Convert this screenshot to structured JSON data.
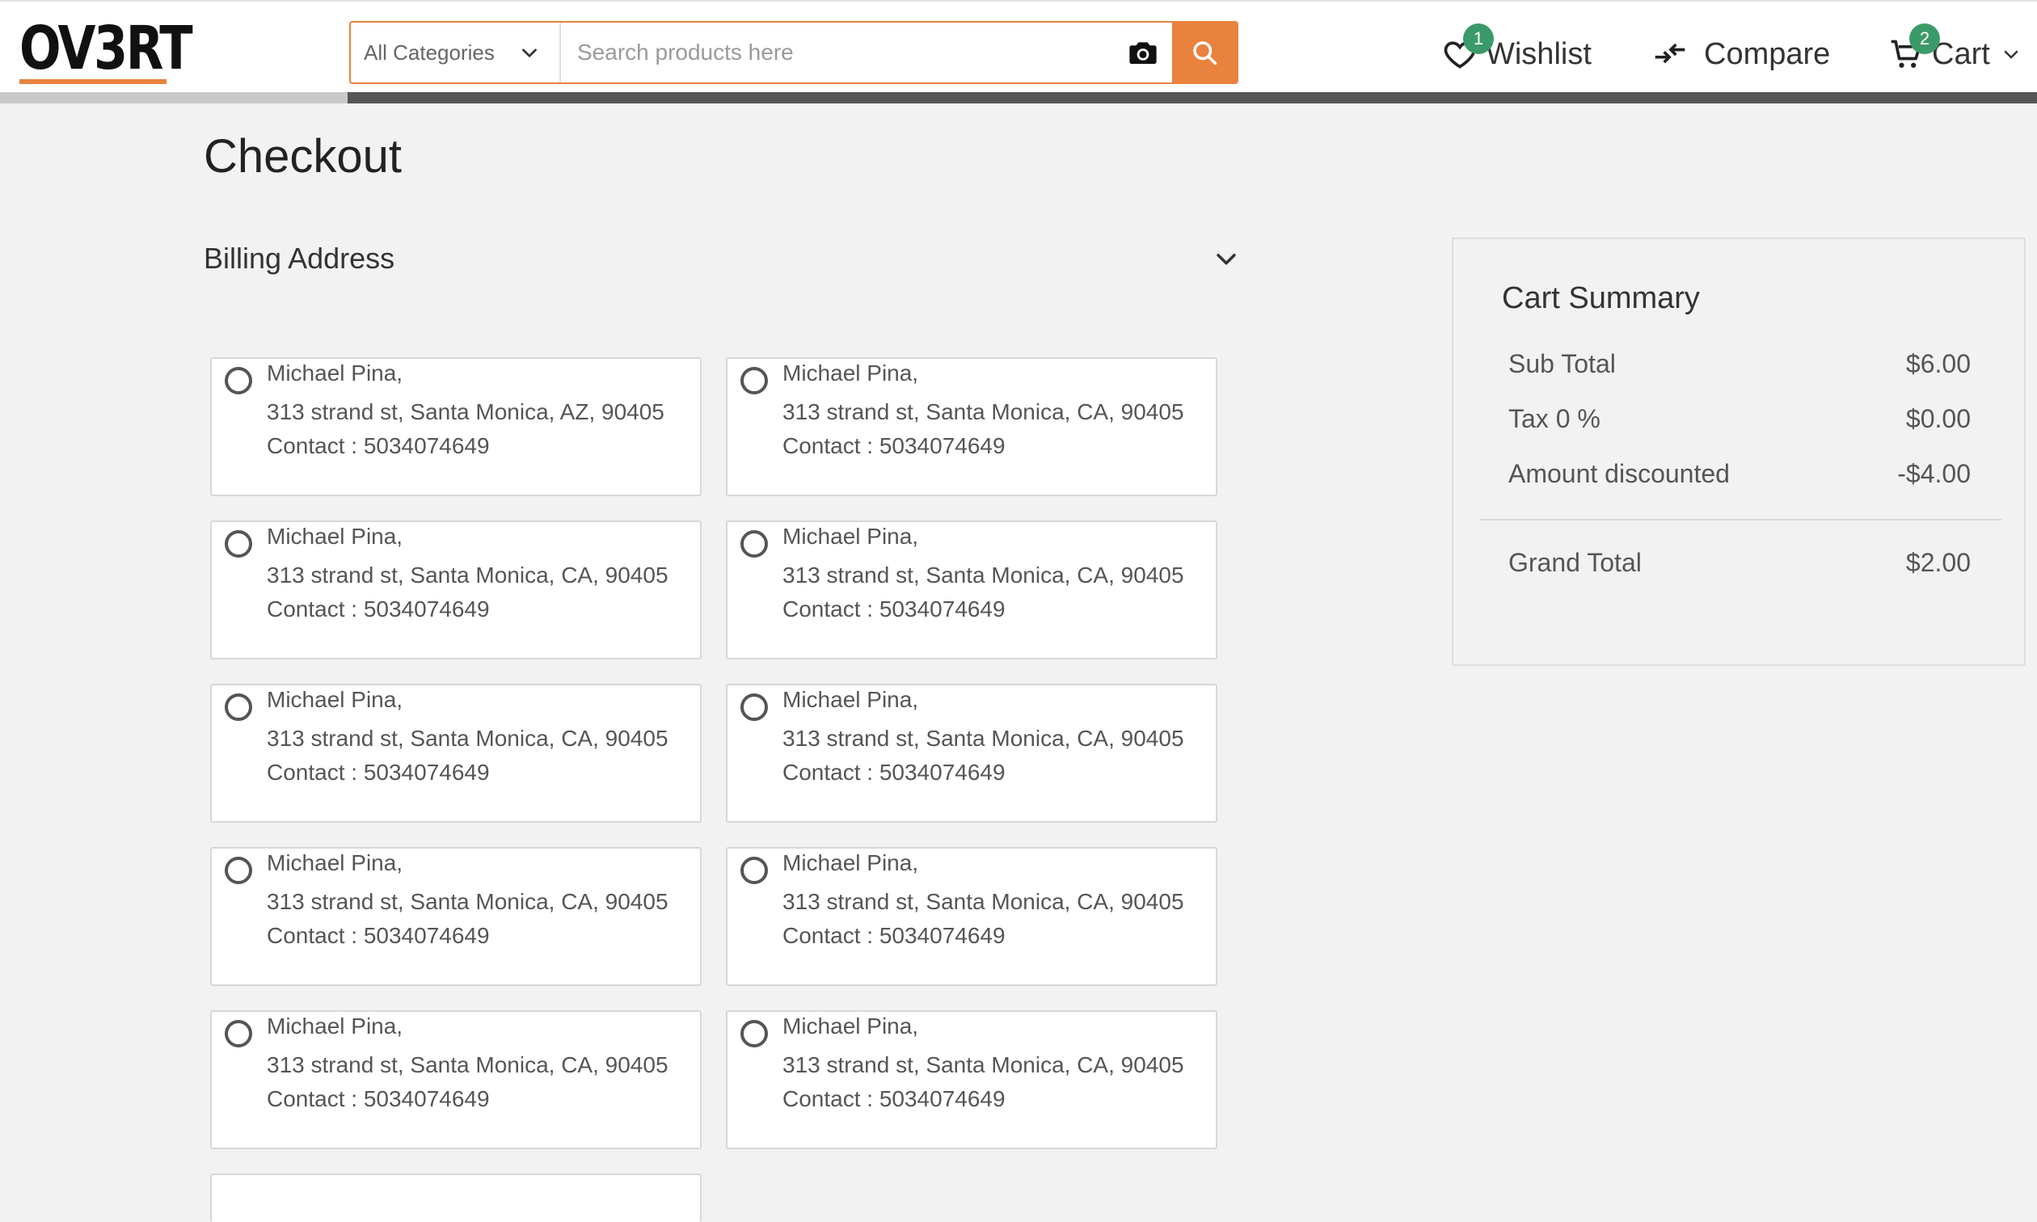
{
  "header": {
    "logo_text": "OV3RT",
    "search": {
      "category": "All Categories",
      "placeholder": "Search products here",
      "value": ""
    },
    "wishlist": {
      "label": "Wishlist",
      "count": "1"
    },
    "compare": {
      "label": "Compare"
    },
    "cart": {
      "label": "Cart",
      "count": "2"
    }
  },
  "page": {
    "title": "Checkout",
    "billing_title": "Billing Address"
  },
  "addresses": [
    {
      "name": "Michael Pina,",
      "line": "313 strand st, Santa Monica, AZ, 90405",
      "contact": "Contact : 5034074649"
    },
    {
      "name": "Michael Pina,",
      "line": "313 strand st, Santa Monica, CA, 90405",
      "contact": "Contact : 5034074649"
    },
    {
      "name": "Michael Pina,",
      "line": "313 strand st, Santa Monica, CA, 90405",
      "contact": "Contact : 5034074649"
    },
    {
      "name": "Michael Pina,",
      "line": "313 strand st, Santa Monica, CA, 90405",
      "contact": "Contact : 5034074649"
    },
    {
      "name": "Michael Pina,",
      "line": "313 strand st, Santa Monica, CA, 90405",
      "contact": "Contact : 5034074649"
    },
    {
      "name": "Michael Pina,",
      "line": "313 strand st, Santa Monica, CA, 90405",
      "contact": "Contact : 5034074649"
    },
    {
      "name": "Michael Pina,",
      "line": "313 strand st, Santa Monica, CA, 90405",
      "contact": "Contact : 5034074649"
    },
    {
      "name": "Michael Pina,",
      "line": "313 strand st, Santa Monica, CA, 90405",
      "contact": "Contact : 5034074649"
    },
    {
      "name": "Michael Pina,",
      "line": "313 strand st, Santa Monica, CA, 90405",
      "contact": "Contact : 5034074649"
    },
    {
      "name": "Michael Pina,",
      "line": "313 strand st, Santa Monica, CA, 90405",
      "contact": "Contact : 5034074649"
    }
  ],
  "summary": {
    "title": "Cart Summary",
    "subtotal_label": "Sub Total",
    "subtotal_value": "$6.00",
    "tax_label": "Tax 0 %",
    "tax_value": "$0.00",
    "discount_label": "Amount discounted",
    "discount_value": "-$4.00",
    "grand_total_label": "Grand Total",
    "grand_total_value": "$2.00"
  },
  "colors": {
    "accent": "#e8823d",
    "badge": "#3b9a69",
    "background": "#f2f2f2"
  }
}
